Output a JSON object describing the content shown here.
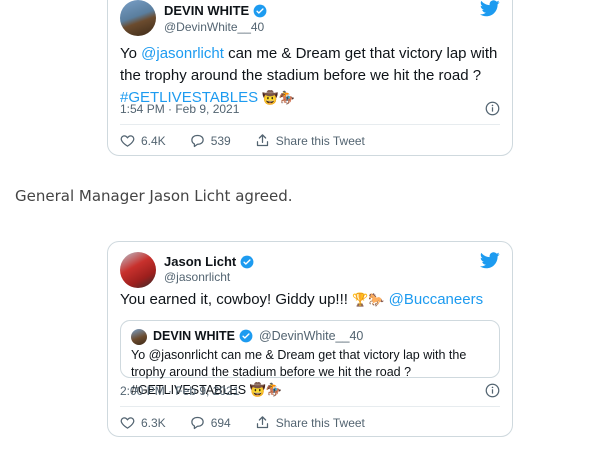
{
  "tweet1": {
    "display_name": "DEVIN WHITE",
    "handle": "@DevinWhite__40",
    "text_pre": "Yo ",
    "mention": "@jasonrlicht",
    "text_post": " can me & Dream get that victory lap with the trophy around the stadium before we hit the road ? ",
    "hashtag": "#GETLIVESTABLES",
    "emojis": "🤠🏇",
    "time": "1:54 PM · Feb 9, 2021",
    "likes": "6.4K",
    "replies": "539",
    "share_label": "Share this Tweet"
  },
  "prose": {
    "text": "General Manager Jason Licht agreed."
  },
  "tweet2": {
    "display_name": "Jason Licht",
    "handle": "@jasonrlicht",
    "text_pre": "You earned it, cowboy!  Giddy up!!! ",
    "emojis": "🏆🐎",
    "mention": "@Buccaneers",
    "quote": {
      "display_name": "DEVIN WHITE",
      "handle": "@DevinWhite__40",
      "text": "Yo @jasonrlicht can me & Dream get that victory lap with the trophy around the stadium before we hit the road ? #GETLIVESTABLES",
      "emojis": "🤠🏇"
    },
    "time": "2:00 PM · Feb 9, 2021",
    "likes": "6.3K",
    "replies": "694",
    "share_label": "Share this Tweet"
  },
  "colors": {
    "link": "#1d9bf0",
    "muted": "#536471",
    "border": "#cfd9de"
  }
}
